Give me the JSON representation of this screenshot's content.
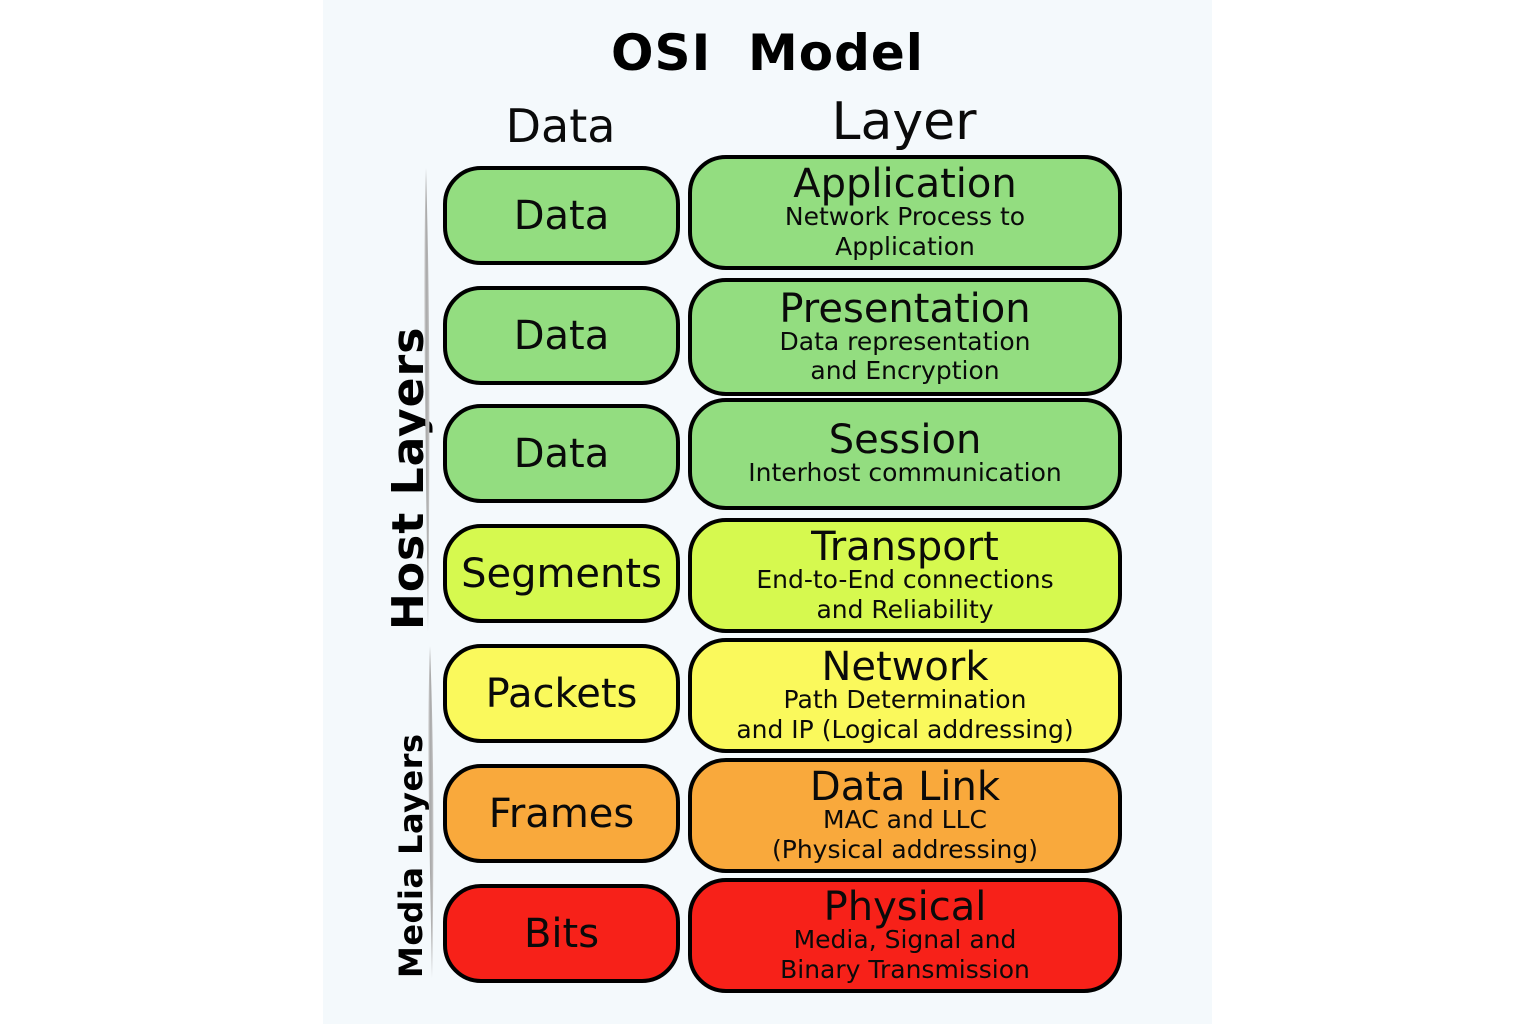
{
  "diagram": {
    "title": "OSI  Model",
    "column_headers": {
      "data": "Data",
      "layer": "Layer"
    },
    "groups": [
      {
        "id": "host",
        "label": "Host Layers"
      },
      {
        "id": "media",
        "label": "Media Layers"
      }
    ],
    "colors": {
      "panel_background": "#f4f9fc",
      "page_background": "#ffffff",
      "border": "#000000",
      "text": "#0a0a0a",
      "spindle": "#b3b3b3",
      "green": "#93dd80",
      "yellow_green": "#d6f94f",
      "yellow": "#faf95c",
      "orange": "#f9a93c",
      "red": "#f72119"
    },
    "rows": [
      {
        "group": "host",
        "data_unit": "Data",
        "layer_name": "Application",
        "layer_desc": "Network Process to\nApplication",
        "color": "#93dd80"
      },
      {
        "group": "host",
        "data_unit": "Data",
        "layer_name": "Presentation",
        "layer_desc": "Data representation\nand Encryption",
        "color": "#93dd80"
      },
      {
        "group": "host",
        "data_unit": "Data",
        "layer_name": "Session",
        "layer_desc": "Interhost communication",
        "color": "#93dd80"
      },
      {
        "group": "host",
        "data_unit": "Segments",
        "layer_name": "Transport",
        "layer_desc": "End-to-End connections\nand Reliability",
        "color": "#d6f94f"
      },
      {
        "group": "media",
        "data_unit": "Packets",
        "layer_name": "Network",
        "layer_desc": "Path Determination\nand IP (Logical addressing)",
        "color": "#faf95c"
      },
      {
        "group": "media",
        "data_unit": "Frames",
        "layer_name": "Data Link",
        "layer_desc": "MAC and LLC\n(Physical addressing)",
        "color": "#f9a93c"
      },
      {
        "group": "media",
        "data_unit": "Bits",
        "layer_name": "Physical",
        "layer_desc": "Media, Signal and\nBinary Transmission",
        "color": "#f72119"
      }
    ]
  }
}
